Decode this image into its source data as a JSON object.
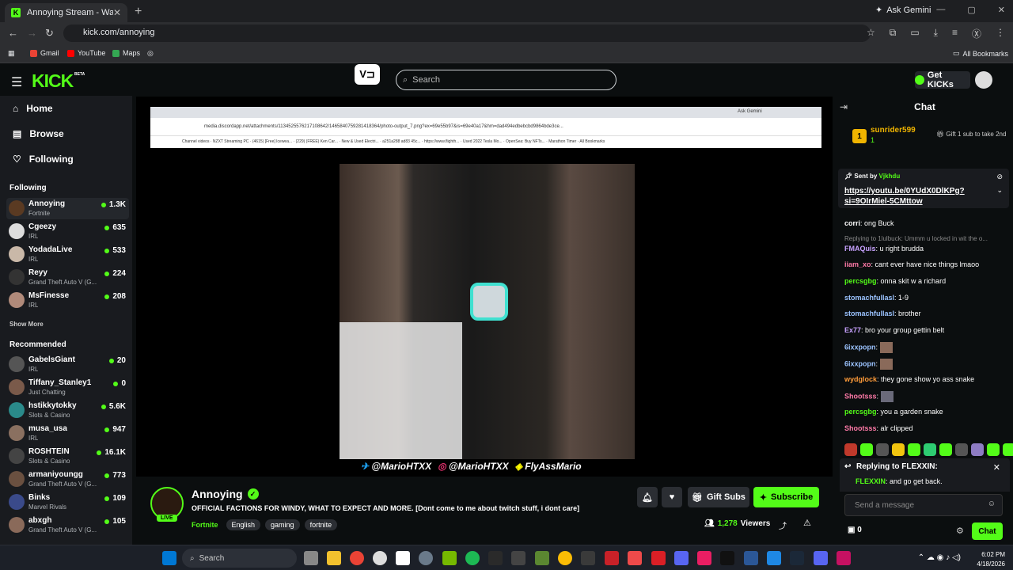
{
  "browser": {
    "tab_title": "Annoying Stream - Watch Live",
    "url": "kick.com/annoying",
    "ask_gemini": "Ask Gemini",
    "bookmarks": [
      "Gmail",
      "YouTube",
      "Maps"
    ],
    "all_bookmarks": "All Bookmarks"
  },
  "header": {
    "logo": "KICK",
    "beta": "BETA",
    "search_placeholder": "Search",
    "get_kicks": "Get KICKs"
  },
  "sidebar": {
    "nav": [
      {
        "label": "Home",
        "icon": "home-icon"
      },
      {
        "label": "Browse",
        "icon": "browse-icon"
      },
      {
        "label": "Following",
        "icon": "heart-icon"
      }
    ],
    "following_heading": "Following",
    "following": [
      {
        "name": "Annoying",
        "category": "Fortnite",
        "viewers": "1.3K"
      },
      {
        "name": "Cgeezy",
        "category": "IRL",
        "viewers": "635"
      },
      {
        "name": "YodadaLive",
        "category": "IRL",
        "viewers": "533"
      },
      {
        "name": "Reyy",
        "category": "Grand Theft Auto V (G...",
        "viewers": "224"
      },
      {
        "name": "MsFinesse",
        "category": "IRL",
        "viewers": "208"
      }
    ],
    "show_more": "Show More",
    "recommended_heading": "Recommended",
    "recommended": [
      {
        "name": "GabelsGiant",
        "category": "IRL",
        "viewers": "20"
      },
      {
        "name": "Tiffany_Stanley1",
        "category": "Just Chatting",
        "viewers": "0"
      },
      {
        "name": "hstikkytokky",
        "category": "Slots & Casino",
        "viewers": "5.6K"
      },
      {
        "name": "musa_usa",
        "category": "IRL",
        "viewers": "947"
      },
      {
        "name": "ROSHTEIN",
        "category": "Slots & Casino",
        "viewers": "16.1K"
      },
      {
        "name": "armaniyoungg",
        "category": "Grand Theft Auto V (G...",
        "viewers": "773"
      },
      {
        "name": "Binks",
        "category": "Marvel Rivals",
        "viewers": "109"
      },
      {
        "name": "abxgh",
        "category": "Grand Theft Auto V (G...",
        "viewers": "105"
      }
    ]
  },
  "video": {
    "inner_url": "media.discordapp.net/attachments/1134525576217108642/1465840759281418364/photo-output_7.png?ex=69e55b97&is=69e40a17&hm=dad494edbebcbd9864bde3ce...",
    "inner_ask_gemini": "Ask Gemini",
    "inner_bookmarks": [
      "Channel videos",
      "NZXT Streaming PC",
      "(4615) [Free] Icewea...",
      "(229) (FREE) Ken Car...",
      "New & Used Electri...",
      "a251a288 ad83 45c...",
      "https://www.flighth...",
      "Used 2022 Tesla Mo...",
      "OpenSea: Buy NFTs...",
      "Marathon Timer",
      "All Bookmarks"
    ],
    "overlay": [
      "@MarioHTXX",
      "@MarioHTXX",
      "FlyAssMario"
    ]
  },
  "stream": {
    "name": "Annoying",
    "live": "LIVE",
    "title": "OFFICIAL FACTIONS FOR WINDY, WHAT TO EXPECT AND MORE.  [Dont come to me about twitch stuff, i dont care]",
    "category": "Fortnite",
    "tags": [
      "English",
      "gaming",
      "fortnite"
    ],
    "gift_subs": "Gift Subs",
    "subscribe": "Subscribe",
    "viewers": "1,278",
    "viewers_label": "Viewers"
  },
  "chat": {
    "title": "Chat",
    "top_gifter": "sunrider599",
    "top_gifter_rank": "1",
    "top_gifter_count": "1",
    "gift_text": "Gift 1 sub to take 2nd",
    "pinned_sent_by": "Sent by",
    "pinned_user": "Vjkhdu",
    "pinned_link": "https://youtu.be/0YUdX0DlKPg?si=9OIrMiel-5CMttow",
    "messages": [
      {
        "user": "corri",
        "color": "#ffffff",
        "text": "ong Buck"
      },
      {
        "reply": "Replying to 1lulbuck: Ummm u locked in wit the o..."
      },
      {
        "user": "FMAQuis",
        "color": "#c8a2ff",
        "text": "u right brudda"
      },
      {
        "user": "iiam_xo",
        "color": "#ff7aa8",
        "text": "cant ever have nice things lmaoo"
      },
      {
        "user": "percsgbg",
        "color": "#53fc18",
        "text": "onna skit w a richard"
      },
      {
        "user": "stomachfullasl",
        "color": "#9bc3ff",
        "text": "1-9"
      },
      {
        "user": "stomachfullasl",
        "color": "#9bc3ff",
        "text": "brother"
      },
      {
        "user": "Ex77",
        "color": "#c8a2ff",
        "text": "bro your group gettin belt"
      },
      {
        "user": "6ixxpopn",
        "color": "#9bc3ff",
        "text": ""
      },
      {
        "user": "6ixxpopn",
        "color": "#9bc3ff",
        "text": ""
      },
      {
        "user": "wydglock",
        "color": "#ff9c3a",
        "text": "they gone show yo ass snake"
      },
      {
        "user": "Shootsss",
        "color": "#ff7aa8",
        "text": ""
      },
      {
        "user": "percsgbg",
        "color": "#53fc18",
        "text": "you a garden snake"
      },
      {
        "user": "Shootsss",
        "color": "#ff7aa8",
        "text": "alr clipped"
      }
    ],
    "replying_to": "Replying to FLEXXIN:",
    "reply_user": "FLEXXIN",
    "reply_text": "and go get back.",
    "send_placeholder": "Send a message",
    "kicks_count": "0",
    "chat_button": "Chat"
  },
  "taskbar": {
    "search": "Search",
    "time": "6:02 PM",
    "date": "4/18/2026"
  }
}
